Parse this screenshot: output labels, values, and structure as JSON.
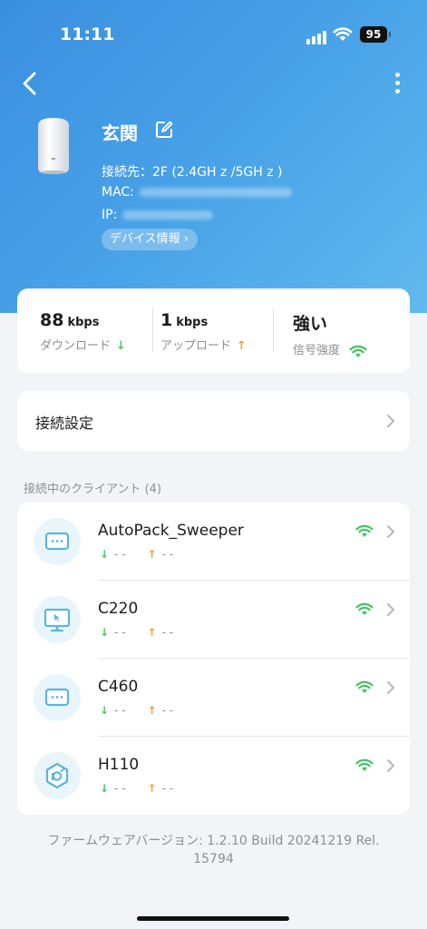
{
  "status_bar": {
    "time": "11:11",
    "battery": "95"
  },
  "device": {
    "name": "玄関",
    "connection": "接続先：2F (2.4GH z /5GH z )",
    "mac_label": "MAC:",
    "ip_label": "IP:",
    "info_button": "デバイス情報 ›"
  },
  "stats": {
    "download_value": "88",
    "download_unit": "kbps",
    "download_label": "ダウンロード",
    "upload_value": "1",
    "upload_unit": "kbps",
    "upload_label": "アップロード",
    "signal_value": "強い",
    "signal_label": "信号強度",
    "arrow_down": "↓",
    "arrow_up": "↑"
  },
  "settings": {
    "label": "接続設定"
  },
  "clients_section": {
    "title": "接続中のクライアント (4)"
  },
  "clients": [
    {
      "name": "AutoPack_Sweeper",
      "down": "- -",
      "up": "- -",
      "icon": "monitor-box-icon"
    },
    {
      "name": "C220",
      "down": "- -",
      "up": "- -",
      "icon": "desktop-icon"
    },
    {
      "name": "C460",
      "down": "- -",
      "up": "- -",
      "icon": "monitor-box-icon"
    },
    {
      "name": "H110",
      "down": "- -",
      "up": "- -",
      "icon": "hub-icon"
    }
  ],
  "firmware": {
    "line1": "ファームウェアバージョン: 1.2.10 Build 20241219 Rel.",
    "line2": "15794"
  },
  "colors": {
    "header_blue": "#3a8fe0",
    "wifi_green": "#4cc46c",
    "up_orange": "#f0a030",
    "icon_blue": "#5cb6dc"
  }
}
